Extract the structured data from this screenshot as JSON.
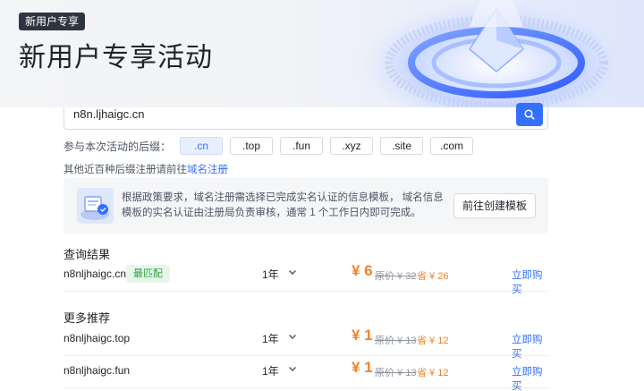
{
  "header": {
    "badge": "新用户专享",
    "title": "新用户专享活动"
  },
  "search": {
    "value": "n8n.ljhaigc.cn"
  },
  "suffixes": {
    "label": "参与本次活动的后缀：",
    "items": [
      ".cn",
      ".top",
      ".fun",
      ".xyz",
      ".site",
      ".com"
    ],
    "active_index": 0
  },
  "other": {
    "text": "其他近百种后缀注册请前往",
    "link": "域名注册"
  },
  "notice": {
    "text": "根据政策要求，域名注册需选择已完成实名认证的信息模板， 域名信息模板的实名认证由注册局负责审核，通常 1 个工作日内即可完成。",
    "button": "前往创建模板"
  },
  "results": {
    "title": "查询结果",
    "items": [
      {
        "domain": "n8nljhaigc.cn",
        "tag": "最匹配",
        "period": "1年",
        "price": "¥ 6",
        "original": "原价 ¥ 32",
        "save": "省 ¥ 26",
        "action": "立即购买"
      }
    ]
  },
  "more": {
    "title": "更多推荐",
    "items": [
      {
        "domain": "n8nljhaigc.top",
        "period": "1年",
        "price": "¥ 1",
        "original": "原价 ¥ 13",
        "save": "省 ¥ 12",
        "action": "立即购买"
      },
      {
        "domain": "n8nljhaigc.fun",
        "period": "1年",
        "price": "¥ 1",
        "original": "原价 ¥ 13",
        "save": "省 ¥ 12",
        "action": "立即购买"
      }
    ]
  },
  "colors": {
    "primary": "#3370ff",
    "price": "#f2822b",
    "match_tag": "#2ea043"
  }
}
